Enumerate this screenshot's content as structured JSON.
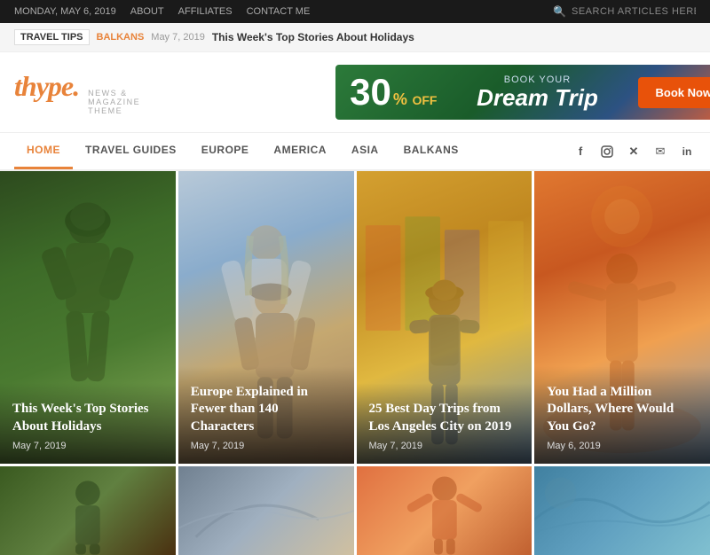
{
  "topbar": {
    "date": "MONDAY, MAY 6, 2019",
    "links": [
      "ABOUT",
      "AFFILIATES",
      "CONTACT ME"
    ],
    "search_placeholder": "SEARCH ARTICLES HERE..."
  },
  "ticker": {
    "label": "TRAVEL TIPS",
    "category": "BALKANS",
    "date": "May 7, 2019",
    "story": "This Week's Top Stories About Holidays"
  },
  "header": {
    "logo": "thype.",
    "tagline": "NEWS & MAGAZINE THEME"
  },
  "ad": {
    "discount": "30",
    "percent": "%",
    "off": "OFF",
    "book_your": "BOOK YOUR",
    "dream_trip": "Dream Trip",
    "button": "Book Now"
  },
  "nav": {
    "items": [
      "HOME",
      "TRAVEL GUIDES",
      "EUROPE",
      "AMERICA",
      "ASIA",
      "BALKANS"
    ],
    "active": "HOME",
    "social_icons": [
      "f",
      "◎",
      "✦",
      "✉",
      "in"
    ]
  },
  "featured": [
    {
      "title": "This Week's Top Stories About Holidays",
      "date": "May 7, 2019"
    },
    {
      "title": "Europe Explained in Fewer than 140 Characters",
      "date": "May 7, 2019"
    },
    {
      "title": "25 Best Day Trips from Los Angeles City on 2019",
      "date": "May 7, 2019"
    },
    {
      "title": "You Had a Million Dollars, Where Would You Go?",
      "date": "May 6, 2019"
    }
  ],
  "thumbs": [
    {
      "id": "thumb1"
    },
    {
      "id": "thumb2"
    },
    {
      "id": "thumb3"
    },
    {
      "id": "thumb4"
    }
  ]
}
